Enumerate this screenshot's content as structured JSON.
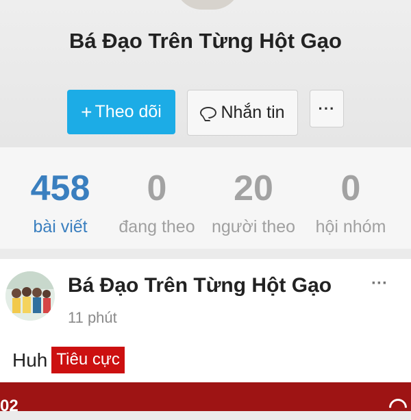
{
  "profile": {
    "name": "Bá Đạo Trên Từng Hột Gạo",
    "follow_button": {
      "icon": "plus-icon",
      "label": "Theo dõi"
    },
    "message_button": {
      "icon": "chat-bubble-icon",
      "label": "Nhắn tin"
    },
    "more_button": {
      "icon": "more-horizontal-icon",
      "label": "···"
    }
  },
  "stats": [
    {
      "value": "458",
      "label": "bài viết"
    },
    {
      "value": "0",
      "label": "đang theo"
    },
    {
      "value": "20",
      "label": "người theo"
    },
    {
      "value": "0",
      "label": "hội nhóm"
    }
  ],
  "post": {
    "author": "Bá Đạo Trên Từng Hột Gạo",
    "time": "11 phút",
    "more_label": "···",
    "text": "Huh",
    "tag": "Tiêu cực",
    "tag_color": "#cc1010"
  },
  "banner": {
    "text": "02",
    "icon": "wifi-icon"
  },
  "colors": {
    "accent": "#1cace6",
    "active_stat": "#3a7fbf",
    "banner": "#9e1414"
  }
}
